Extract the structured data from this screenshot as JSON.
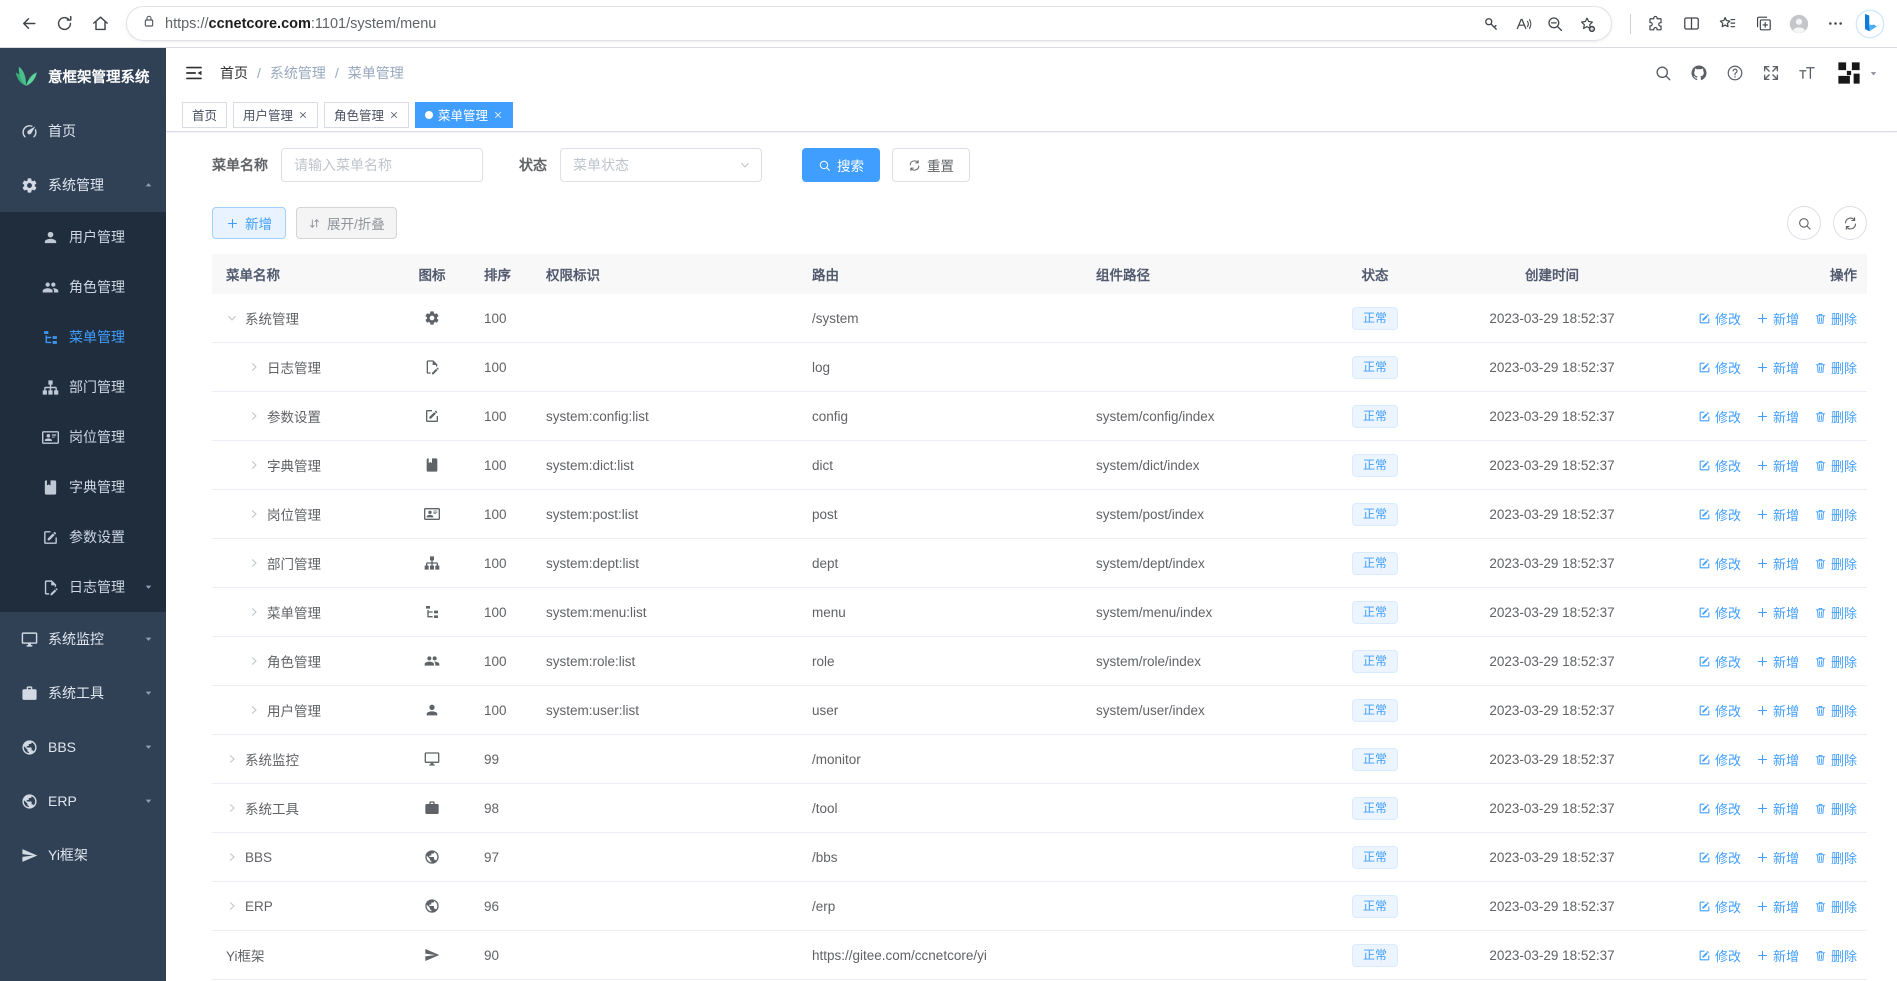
{
  "browser": {
    "url": {
      "scheme": "https://",
      "host": "ccnetcore.com",
      "path": ":1101/system/menu"
    },
    "left_icons": [
      "back",
      "reload",
      "home"
    ],
    "urlbar_icons": [
      "key",
      "readaloud",
      "zoomout",
      "starplus"
    ],
    "toolbar_icons": [
      "extensions",
      "split",
      "favstar",
      "collections",
      "profile",
      "more"
    ]
  },
  "sidebar": {
    "logo_text": "意框架管理系统",
    "items": [
      {
        "key": "home",
        "label": "首页",
        "icon": "dashboard",
        "level": 1
      },
      {
        "key": "system-mgmt",
        "label": "系统管理",
        "icon": "gear",
        "level": 1,
        "caret": "up"
      },
      {
        "key": "user-mgmt",
        "label": "用户管理",
        "icon": "user",
        "level": 2
      },
      {
        "key": "role-mgmt",
        "label": "角色管理",
        "icon": "users",
        "level": 2
      },
      {
        "key": "menu-mgmt",
        "label": "菜单管理",
        "icon": "tree",
        "level": 2,
        "active": true
      },
      {
        "key": "dept-mgmt",
        "label": "部门管理",
        "icon": "sitemap",
        "level": 2
      },
      {
        "key": "post-mgmt",
        "label": "岗位管理",
        "icon": "idcard",
        "level": 2
      },
      {
        "key": "dict-mgmt",
        "label": "字典管理",
        "icon": "book",
        "level": 2
      },
      {
        "key": "config-setting",
        "label": "参数设置",
        "icon": "editsq",
        "level": 2
      },
      {
        "key": "log-mgmt",
        "label": "日志管理",
        "icon": "logdoc",
        "level": 2,
        "caret": "down"
      },
      {
        "key": "sys-monitor",
        "label": "系统监控",
        "icon": "monitor",
        "level": 1,
        "caret": "down"
      },
      {
        "key": "sys-tools",
        "label": "系统工具",
        "icon": "briefcase",
        "level": 1,
        "caret": "down"
      },
      {
        "key": "bbs",
        "label": "BBS",
        "icon": "globe",
        "level": 1,
        "caret": "down"
      },
      {
        "key": "erp",
        "label": "ERP",
        "icon": "globe",
        "level": 1,
        "caret": "down"
      },
      {
        "key": "yi-framework",
        "label": "Yi框架",
        "icon": "plane",
        "level": 1
      }
    ]
  },
  "header": {
    "breadcrumb": [
      "首页",
      "系统管理",
      "菜单管理"
    ],
    "icons": [
      "search",
      "github",
      "question",
      "fullscreen",
      "fontsize"
    ]
  },
  "tabs": [
    {
      "key": "home",
      "label": "首页",
      "closable": false,
      "active": false
    },
    {
      "key": "user-mgmt",
      "label": "用户管理",
      "closable": true,
      "active": false
    },
    {
      "key": "role-mgmt",
      "label": "角色管理",
      "closable": true,
      "active": false
    },
    {
      "key": "menu-mgmt",
      "label": "菜单管理",
      "closable": true,
      "active": true
    }
  ],
  "filters": {
    "name_label": "菜单名称",
    "name_placeholder": "请输入菜单名称",
    "status_label": "状态",
    "status_placeholder": "菜单状态",
    "search_label": "搜索",
    "reset_label": "重置"
  },
  "toolbar": {
    "add_label": "新增",
    "expand_label": "展开/折叠"
  },
  "table": {
    "columns": [
      "菜单名称",
      "图标",
      "排序",
      "权限标识",
      "路由",
      "组件路径",
      "状态",
      "创建时间",
      "操作"
    ],
    "actions": {
      "edit": "修改",
      "add": "新增",
      "delete": "删除"
    },
    "rows": [
      {
        "name": "系统管理",
        "icon": "gear",
        "caret": "open",
        "indent": 0,
        "sort": "100",
        "perm": "",
        "route": "/system",
        "component": "",
        "status": "正常",
        "created": "2023-03-29 18:52:37"
      },
      {
        "name": "日志管理",
        "icon": "logdoc",
        "caret": "closed",
        "indent": 1,
        "sort": "100",
        "perm": "",
        "route": "log",
        "component": "",
        "status": "正常",
        "created": "2023-03-29 18:52:37"
      },
      {
        "name": "参数设置",
        "icon": "editsq",
        "caret": "closed",
        "indent": 1,
        "sort": "100",
        "perm": "system:config:list",
        "route": "config",
        "component": "system/config/index",
        "status": "正常",
        "created": "2023-03-29 18:52:37"
      },
      {
        "name": "字典管理",
        "icon": "book",
        "caret": "closed",
        "indent": 1,
        "sort": "100",
        "perm": "system:dict:list",
        "route": "dict",
        "component": "system/dict/index",
        "status": "正常",
        "created": "2023-03-29 18:52:37"
      },
      {
        "name": "岗位管理",
        "icon": "idcard",
        "caret": "closed",
        "indent": 1,
        "sort": "100",
        "perm": "system:post:list",
        "route": "post",
        "component": "system/post/index",
        "status": "正常",
        "created": "2023-03-29 18:52:37"
      },
      {
        "name": "部门管理",
        "icon": "sitemap",
        "caret": "closed",
        "indent": 1,
        "sort": "100",
        "perm": "system:dept:list",
        "route": "dept",
        "component": "system/dept/index",
        "status": "正常",
        "created": "2023-03-29 18:52:37"
      },
      {
        "name": "菜单管理",
        "icon": "tree",
        "caret": "closed",
        "indent": 1,
        "sort": "100",
        "perm": "system:menu:list",
        "route": "menu",
        "component": "system/menu/index",
        "status": "正常",
        "created": "2023-03-29 18:52:37"
      },
      {
        "name": "角色管理",
        "icon": "users",
        "caret": "closed",
        "indent": 1,
        "sort": "100",
        "perm": "system:role:list",
        "route": "role",
        "component": "system/role/index",
        "status": "正常",
        "created": "2023-03-29 18:52:37"
      },
      {
        "name": "用户管理",
        "icon": "user",
        "caret": "closed",
        "indent": 1,
        "sort": "100",
        "perm": "system:user:list",
        "route": "user",
        "component": "system/user/index",
        "status": "正常",
        "created": "2023-03-29 18:52:37"
      },
      {
        "name": "系统监控",
        "icon": "monitor",
        "caret": "closed",
        "indent": 0,
        "sort": "99",
        "perm": "",
        "route": "/monitor",
        "component": "",
        "status": "正常",
        "created": "2023-03-29 18:52:37"
      },
      {
        "name": "系统工具",
        "icon": "briefcase",
        "caret": "closed",
        "indent": 0,
        "sort": "98",
        "perm": "",
        "route": "/tool",
        "component": "",
        "status": "正常",
        "created": "2023-03-29 18:52:37"
      },
      {
        "name": "BBS",
        "icon": "globe",
        "caret": "closed",
        "indent": 0,
        "sort": "97",
        "perm": "",
        "route": "/bbs",
        "component": "",
        "status": "正常",
        "created": "2023-03-29 18:52:37"
      },
      {
        "name": "ERP",
        "icon": "globe",
        "caret": "closed",
        "indent": 0,
        "sort": "96",
        "perm": "",
        "route": "/erp",
        "component": "",
        "status": "正常",
        "created": "2023-03-29 18:52:37"
      },
      {
        "name": "Yi框架",
        "icon": "plane",
        "caret": "none",
        "indent": 0,
        "sort": "90",
        "perm": "",
        "route": "https://gitee.com/ccnetcore/yi",
        "component": "",
        "status": "正常",
        "created": "2023-03-29 18:52:37"
      }
    ]
  },
  "colors": {
    "accent": "#409eff",
    "sidebar_bg": "#304156",
    "submenu_bg": "#1f2d3d",
    "badge_bg": "#ecf5ff",
    "badge_border": "#d9ecff",
    "logo_green": "#49c08b",
    "table_header_bg": "#f8f8f9"
  }
}
